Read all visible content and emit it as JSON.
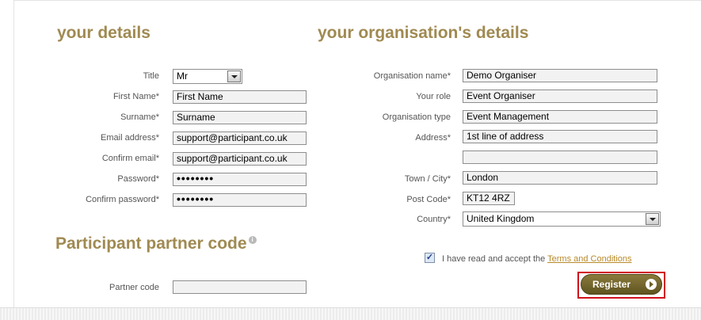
{
  "headings": {
    "your_details": "your details",
    "org_details": "your organisation's details",
    "partner_code": "Participant partner code"
  },
  "info_icon_glyph": "i",
  "personal": {
    "title_label": "Title",
    "title_value": "Mr",
    "first_name_label": "First Name*",
    "first_name_value": "First Name",
    "surname_label": "Surname*",
    "surname_value": "Surname",
    "email_label": "Email address*",
    "email_value": "support@participant.co.uk",
    "confirm_email_label": "Confirm email*",
    "confirm_email_value": "support@participant.co.uk",
    "password_label": "Password*",
    "password_value": "••••••••",
    "confirm_password_label": "Confirm password*",
    "confirm_password_value": "••••••••"
  },
  "organisation": {
    "name_label": "Organisation name*",
    "name_value": "Demo Organiser",
    "role_label": "Your role",
    "role_value": "Event Organiser",
    "type_label": "Organisation type",
    "type_value": "Event Management",
    "address_label": "Address*",
    "address_line1": "1st line of address",
    "address_line2": "",
    "town_label": "Town / City*",
    "town_value": "London",
    "postcode_label": "Post Code*",
    "postcode_value": "KT12 4RZ",
    "country_label": "Country*",
    "country_value": "United Kingdom"
  },
  "partner": {
    "code_label": "Partner code",
    "code_value": ""
  },
  "terms": {
    "checked_glyph": "✓",
    "text": "I have read and accept the ",
    "link": "Terms and Conditions"
  },
  "register_label": "Register",
  "colors": {
    "heading": "#a08a52",
    "register_button": "#6b5f28",
    "highlight_outline": "#d0101c",
    "link": "#b88a2a"
  }
}
